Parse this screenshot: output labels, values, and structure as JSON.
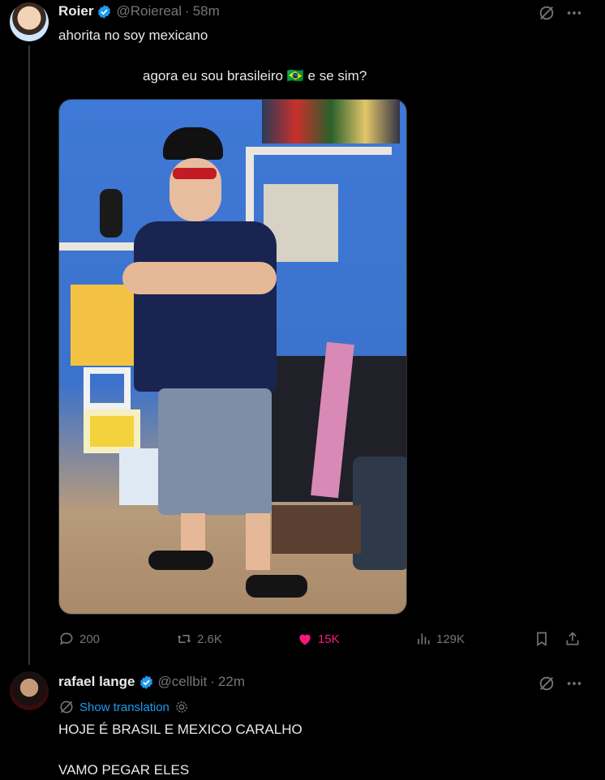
{
  "tweet1": {
    "name": "Roier",
    "handle": "@Roiereal",
    "time": "58m",
    "line1": "ahorita no soy mexicano",
    "line2": "agora eu sou brasileiro 🇧🇷 e se sim?",
    "stats": {
      "replies": "200",
      "retweets": "2.6K",
      "likes": "15K",
      "views": "129K"
    }
  },
  "tweet2": {
    "name": "rafael lange",
    "handle": "@cellbit",
    "time": "22m",
    "show_translation": "Show translation",
    "line1": "HOJE É BRASIL E MEXICO CARALHO",
    "line2": "VAMO PEGAR ELES"
  },
  "colors": {
    "accent": "#1d9bf0",
    "like": "#f91880",
    "muted": "#71767b",
    "text": "#e7e9ea"
  },
  "icons": [
    "verified-badge-icon",
    "grok-icon",
    "more-icon",
    "reply-icon",
    "retweet-icon",
    "like-icon",
    "views-icon",
    "bookmark-icon",
    "share-icon",
    "globe-icon",
    "settings-icon"
  ]
}
